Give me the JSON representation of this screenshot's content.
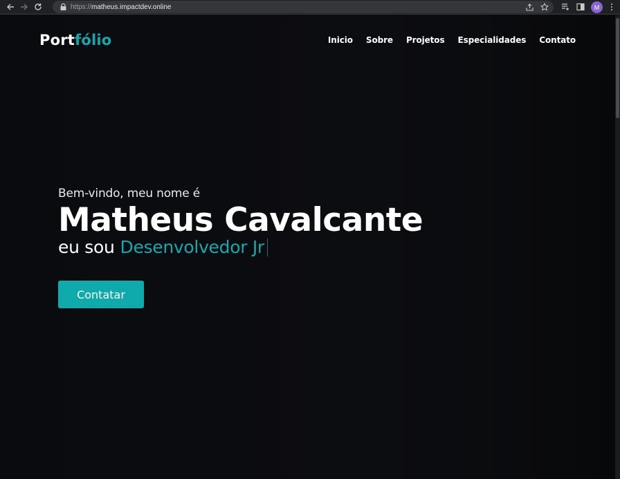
{
  "browser": {
    "url_scheme": "https://",
    "url_host": "matheus.impactdev.online",
    "avatar_initial": "M"
  },
  "logo": {
    "part1": "Port",
    "part2": "fólio"
  },
  "nav": {
    "items": [
      "Inicio",
      "Sobre",
      "Projetos",
      "Especialidades",
      "Contato"
    ]
  },
  "hero": {
    "greeting": "Bem-vindo, meu nome é",
    "name": "Matheus Cavalcante",
    "role_prefix": "eu sou",
    "role": "Desenvolvedor Jr",
    "cta_label": "Contatar"
  },
  "colors": {
    "accent": "#14aaad",
    "background": "#0b0c0f",
    "button": "#0fabac"
  }
}
